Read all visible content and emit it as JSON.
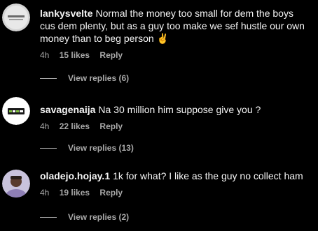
{
  "comments": [
    {
      "username": "lankysvelte",
      "text": "Normal the money too small for dem the boys cus dem plenty, but as a guy too make we sef hustle our own money than to beg person ✌️",
      "time": "4h",
      "likes": "15 likes",
      "reply_label": "Reply",
      "view_replies": "View replies (6)",
      "avatar_icon": "grey-profile-avatar-icon"
    },
    {
      "username": "savagenaija",
      "text": "Na 30 million him suppose give you ?",
      "time": "4h",
      "likes": "22 likes",
      "reply_label": "Reply",
      "view_replies": "View replies (13)",
      "avatar_icon": "brand-logo-avatar-icon"
    },
    {
      "username": "oladejo.hojay.1",
      "text": "1k for what? I like as the guy no collect ham",
      "time": "4h",
      "likes": "19 likes",
      "reply_label": "Reply",
      "view_replies": "View replies (2)",
      "avatar_icon": "person-photo-avatar-icon"
    }
  ]
}
